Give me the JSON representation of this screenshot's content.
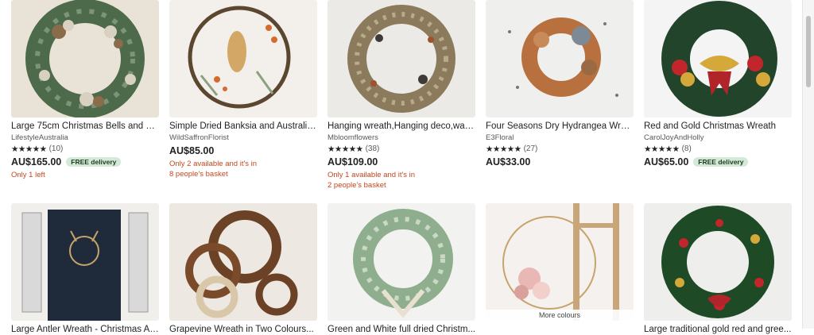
{
  "row1": [
    {
      "title": "Large 75cm Christmas Bells and Pi...",
      "shop": "LifestyleAustralia",
      "stars": "★★★★★",
      "reviews": "(10)",
      "price": "AU$165.00",
      "badge": "FREE delivery",
      "note1": "Only 1 left",
      "note2": ""
    },
    {
      "title": "Simple Dried Banksia and Australia...",
      "shop": "WildSaffronFlorist",
      "stars": "",
      "reviews": "",
      "price": "AU$85.00",
      "badge": "",
      "note1": "Only 2 available and it's in",
      "note2": "8 people's basket"
    },
    {
      "title": "Hanging wreath,Hanging deco,wall...",
      "shop": "Mbloomflowers",
      "stars": "★★★★★",
      "reviews": "(38)",
      "price": "AU$109.00",
      "badge": "",
      "note1": "Only 1 available and it's in",
      "note2": "2 people's basket"
    },
    {
      "title": "Four Seasons Dry Hydrangea Wrea...",
      "shop": "E3Floral",
      "stars": "★★★★★",
      "reviews": "(27)",
      "price": "AU$33.00",
      "badge": "",
      "note1": "",
      "note2": ""
    },
    {
      "title": "Red and Gold Christmas Wreath",
      "shop": "CarolJoyAndHolly",
      "stars": "★★★★★",
      "reviews": "(8)",
      "price": "AU$65.00",
      "badge": "FREE delivery",
      "note1": "",
      "note2": ""
    }
  ],
  "row2": [
    {
      "title": "Large Antler Wreath - Christmas At..."
    },
    {
      "title": "Grapevine Wreath in Two Colours..."
    },
    {
      "title": "Green and White full dried Christm..."
    },
    {
      "title": "",
      "overlay": "More colours"
    },
    {
      "title": "Large traditional gold red and gree..."
    }
  ]
}
